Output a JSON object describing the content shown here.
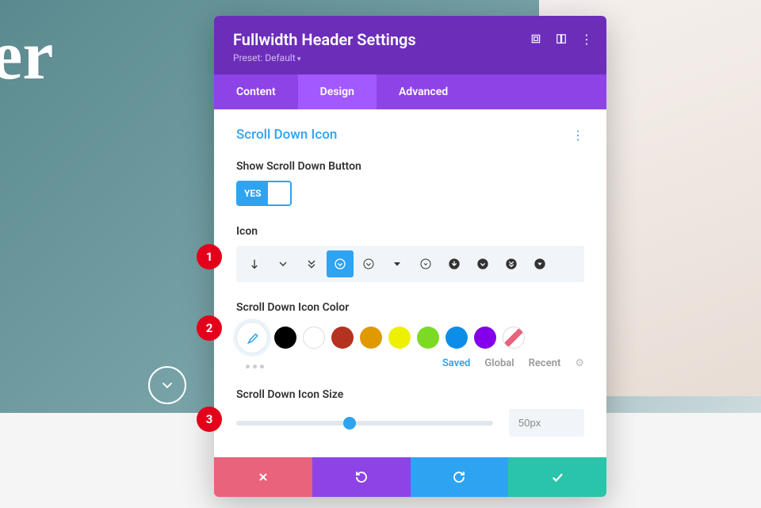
{
  "bg_text": "ter",
  "modal": {
    "title": "Fullwidth Header Settings",
    "preset_label": "Preset: Default"
  },
  "tabs": {
    "content": "Content",
    "design": "Design",
    "advanced": "Advanced"
  },
  "section": {
    "title": "Scroll Down Icon"
  },
  "fields": {
    "show_button_label": "Show Scroll Down Button",
    "toggle_yes": "YES",
    "icon_label": "Icon",
    "color_label": "Scroll Down Icon Color",
    "size_label": "Scroll Down Icon Size",
    "size_value": "50px"
  },
  "color_presets": {
    "saved": "Saved",
    "global": "Global",
    "recent": "Recent"
  },
  "colors": [
    "#000000",
    "#ffffff",
    "#b5321e",
    "#e09900",
    "#edf000",
    "#7cda24",
    "#0c8ee8",
    "#8300e9"
  ],
  "markers": {
    "m1": "1",
    "m2": "2",
    "m3": "3"
  }
}
